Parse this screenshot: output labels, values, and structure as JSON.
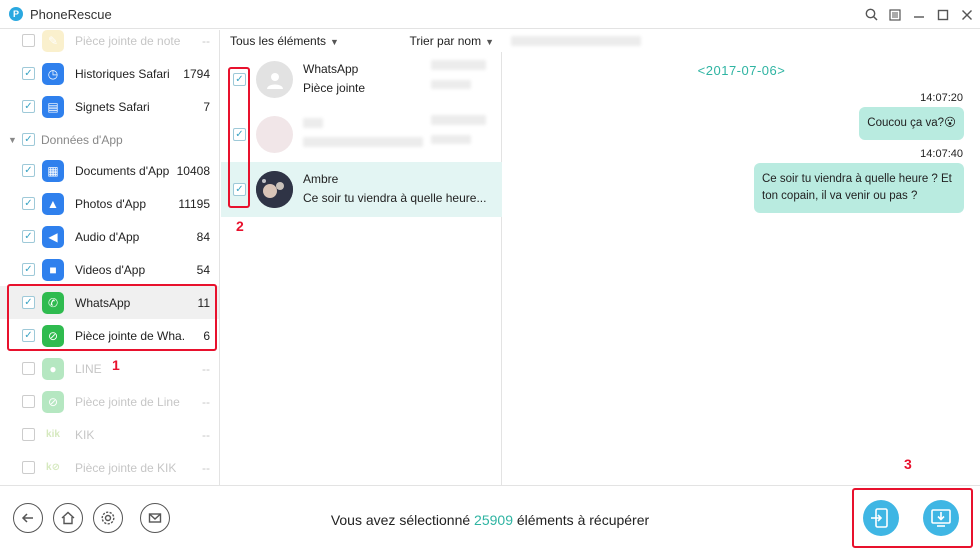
{
  "app": {
    "title": "PhoneRescue",
    "logo_letter": "P"
  },
  "window_controls": {
    "search": "⌕",
    "menu": "☰",
    "minimize": "—",
    "maximize": "☐",
    "close": "✕"
  },
  "sidebar": {
    "rows": [
      {
        "label": "Pièce jointe de note",
        "count": "--",
        "checked": false,
        "disabled": true,
        "icon": "note-attachment-icon",
        "color": "#f2c94c"
      },
      {
        "label": "Historiques Safari",
        "count": "1794",
        "checked": true,
        "disabled": false,
        "icon": "safari-icon",
        "color": "#2f80ed"
      },
      {
        "label": "Signets Safari",
        "count": "7",
        "checked": true,
        "disabled": false,
        "icon": "bookmark-icon",
        "color": "#2f80ed"
      },
      {
        "label": "Données d'App",
        "group": true,
        "checked": true
      },
      {
        "label": "Documents d'App",
        "count": "10408",
        "checked": true,
        "disabled": false,
        "icon": "document-icon",
        "color": "#2f80ed"
      },
      {
        "label": "Photos d'App",
        "count": "11195",
        "checked": true,
        "disabled": false,
        "icon": "photo-icon",
        "color": "#2f80ed"
      },
      {
        "label": "Audio d'App",
        "count": "84",
        "checked": true,
        "disabled": false,
        "icon": "audio-icon",
        "color": "#2f80ed"
      },
      {
        "label": "Videos d'App",
        "count": "54",
        "checked": true,
        "disabled": false,
        "icon": "video-icon",
        "color": "#2f80ed"
      },
      {
        "label": "WhatsApp",
        "count": "11",
        "checked": true,
        "disabled": false,
        "icon": "whatsapp-icon",
        "color": "#2fbb4f",
        "selected": true
      },
      {
        "label": "Pièce jointe de Wha...",
        "count": "6",
        "checked": true,
        "disabled": false,
        "icon": "whatsapp-attachment-icon",
        "color": "#2fbb4f"
      },
      {
        "label": "LINE",
        "count": "--",
        "checked": false,
        "disabled": true,
        "icon": "line-icon",
        "color": "#2fbb4f"
      },
      {
        "label": "Pièce jointe de Line",
        "count": "--",
        "checked": false,
        "disabled": true,
        "icon": "line-attachment-icon",
        "color": "#2fbb4f"
      },
      {
        "label": "KIK",
        "count": "--",
        "checked": false,
        "disabled": true,
        "icon": "kik-icon",
        "color": "#8bc34a"
      },
      {
        "label": "Pièce jointe de KIK",
        "count": "--",
        "checked": false,
        "disabled": true,
        "icon": "kik-attachment-icon",
        "color": "#8bc34a"
      }
    ]
  },
  "middle": {
    "filter_label": "Tous les éléments",
    "sort_label": "Trier par nom",
    "items": [
      {
        "name": "WhatsApp",
        "subtitle": "Pièce jointe",
        "checked": true
      },
      {
        "name": "",
        "subtitle": "",
        "checked": true,
        "blurred": true
      },
      {
        "name": "Ambre",
        "subtitle": "Ce soir tu viendra à quelle heure...",
        "checked": true
      }
    ]
  },
  "chat": {
    "date": "<2017-07-06>",
    "messages": [
      {
        "time": "14:07:20",
        "text": "Coucou ça va?😮"
      },
      {
        "time": "14:07:40",
        "text": "Ce soir tu viendra à quelle heure ? Et ton copain, il va venir ou pas ?"
      }
    ]
  },
  "bottom": {
    "selection_prefix": "Vous avez sélectionné",
    "selection_count": "25909",
    "selection_suffix": "éléments à récupérer"
  },
  "annotations": {
    "one": "1",
    "two": "2",
    "three": "3"
  },
  "colors": {
    "accent": "#2fb4a2",
    "bubble": "#b9ebe0",
    "annotation": "#e8112d",
    "action": "#3fb6e4"
  }
}
